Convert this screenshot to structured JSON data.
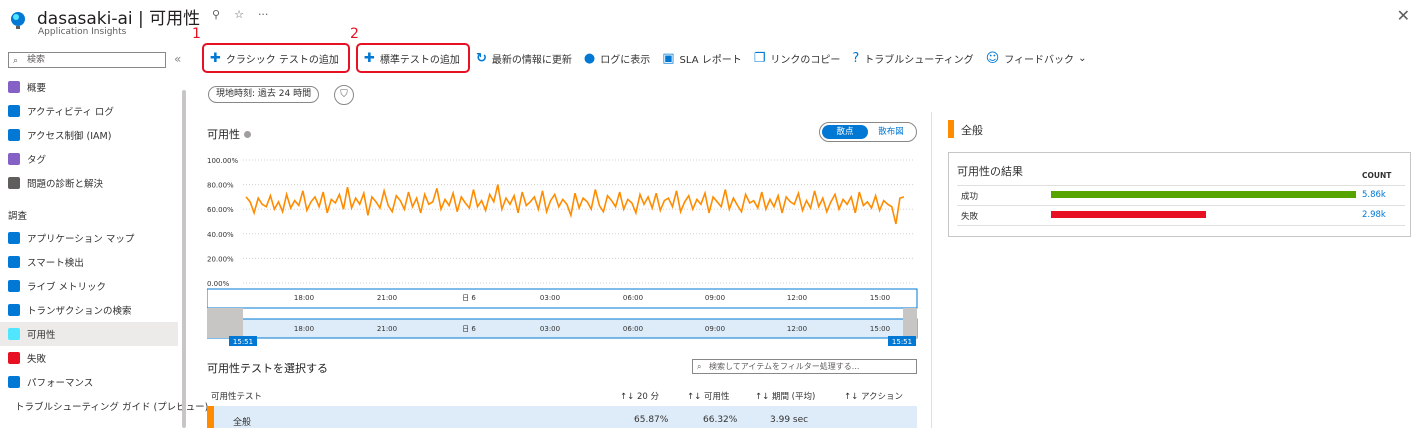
{
  "header": {
    "title": "dasasaki-ai | 可用性",
    "subtitle": "Application Insights",
    "close": "✕"
  },
  "sidebar": {
    "search_placeholder": "検索",
    "items_top": [
      {
        "label": "概要",
        "color": "#8661c5"
      },
      {
        "label": "アクティビティ ログ",
        "color": "#0078d4"
      },
      {
        "label": "アクセス制御 (IAM)",
        "color": "#0078d4"
      },
      {
        "label": "タグ",
        "color": "#8661c5"
      },
      {
        "label": "問題の診断と解決",
        "color": "#605e5c"
      }
    ],
    "section_investigate": "調査",
    "items_investigate": [
      {
        "label": "アプリケーション マップ",
        "color": "#0078d4"
      },
      {
        "label": "スマート検出",
        "color": "#0078d4"
      },
      {
        "label": "ライブ メトリック",
        "color": "#0078d4"
      },
      {
        "label": "トランザクションの検索",
        "color": "#0078d4"
      },
      {
        "label": "可用性",
        "color": "#50e6ff",
        "active": true
      },
      {
        "label": "失敗",
        "color": "#e81123"
      },
      {
        "label": "パフォーマンス",
        "color": "#0078d4"
      },
      {
        "label": "トラブルシューティング ガイド (プレビュー)",
        "color": "#57a300"
      }
    ]
  },
  "toolbar": {
    "add_classic": "クラシック テストの追加",
    "add_standard": "標準テストの追加",
    "refresh": "最新の情報に更新",
    "logs": "ログに表示",
    "sla": "SLA レポート",
    "copy_link": "リンクのコピー",
    "troubleshoot": "トラブルシューティング",
    "feedback": "フィードバック",
    "annotation_1": "1",
    "annotation_2": "2"
  },
  "filters": {
    "time_range": "現地時刻: 過去 24 時間"
  },
  "chart_panel": {
    "title": "可用性",
    "toggle_scatter": "散点",
    "toggle_distribution": "散布図",
    "time_start_label": "15:51",
    "time_end_label": "15:51"
  },
  "chart_data": {
    "type": "line",
    "title": "可用性",
    "y_ticks": [
      "100.00%",
      "80.00%",
      "60.00%",
      "40.00%",
      "20.00%",
      "0.00%"
    ],
    "x_ticks": [
      "18:00",
      "21:00",
      "日 6",
      "03:00",
      "06:00",
      "09:00",
      "12:00",
      "15:00"
    ],
    "ylim": [
      0,
      100
    ],
    "series": [
      {
        "color": "#ff8c00",
        "values": [
          70,
          66,
          57,
          69,
          64,
          62,
          71,
          60,
          66,
          58,
          72,
          61,
          67,
          63,
          75,
          59,
          66,
          70,
          62,
          74,
          57,
          68,
          65,
          72,
          60,
          78,
          61,
          69,
          64,
          73,
          55,
          70,
          66,
          61,
          75,
          63,
          58,
          71,
          67,
          60,
          74,
          62,
          69,
          57,
          72,
          64,
          66,
          77,
          60,
          68,
          63,
          73,
          58,
          70,
          65,
          61,
          76,
          62,
          67,
          59,
          72,
          66,
          80,
          60,
          69,
          64,
          71,
          57,
          74,
          63,
          66,
          70,
          60,
          75,
          58,
          67,
          72,
          62,
          68,
          64,
          55,
          73,
          61,
          69,
          66,
          60,
          76,
          63,
          58,
          71,
          67,
          62,
          74,
          60,
          68,
          65,
          57,
          72,
          64,
          70,
          61,
          73,
          59,
          67,
          69,
          62,
          75,
          58,
          66,
          71,
          60,
          68,
          64,
          73,
          57,
          70,
          66,
          62,
          76,
          60,
          69,
          63,
          58,
          72,
          65,
          67,
          61,
          74,
          60,
          68,
          62,
          71,
          57,
          70,
          66,
          64,
          73,
          59,
          67,
          61,
          75,
          62,
          69,
          58,
          66,
          72,
          60,
          68,
          64,
          70,
          57,
          74,
          63,
          66,
          61,
          71,
          59,
          67,
          64,
          62,
          48,
          69,
          70
        ]
      }
    ]
  },
  "tests": {
    "title": "可用性テストを選択する",
    "search_placeholder": "検索してアイテムをフィルター処理する...",
    "columns": [
      "可用性テスト",
      "20 分",
      "可用性",
      "期間 (平均)",
      "アクション"
    ],
    "rows": [
      {
        "name": "全般",
        "last20": "65.87%",
        "availability": "66.32%",
        "duration": "3.99 sec"
      }
    ]
  },
  "right_panel": {
    "general_title": "全般",
    "results_title": "可用性の結果",
    "count_header": "COUNT",
    "success_label": "成功",
    "success_value": "5.86k",
    "success_color": "#57a300",
    "failed_label": "失敗",
    "failed_value": "2.98k",
    "failed_color": "#e81123"
  }
}
